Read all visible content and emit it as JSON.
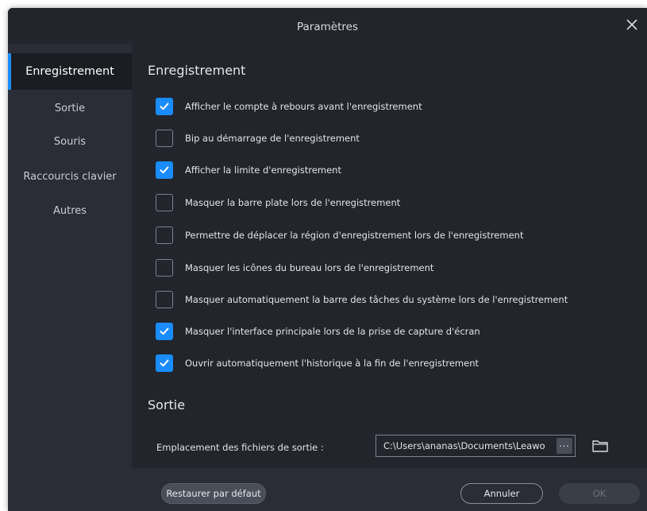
{
  "window": {
    "title": "Paramètres",
    "close_icon": "close-icon"
  },
  "sidebar": {
    "items": [
      {
        "label": "Enregistrement",
        "active": true
      },
      {
        "label": "Sortie",
        "active": false
      },
      {
        "label": "Souris",
        "active": false
      },
      {
        "label": "Raccourcis clavier",
        "active": false
      },
      {
        "label": "Autres",
        "active": false
      }
    ]
  },
  "recording": {
    "section_title": "Enregistrement",
    "options": [
      {
        "label": "Afficher le compte à rebours avant l'enregistrement",
        "checked": true
      },
      {
        "label": "Bip au démarrage de l'enregistrement",
        "checked": false
      },
      {
        "label": "Afficher la limite d'enregistrement",
        "checked": true
      },
      {
        "label": "Masquer la barre plate lors de l'enregistrement",
        "checked": false
      },
      {
        "label": "Permettre de déplacer la région d'enregistrement lors de l'enregistrement",
        "checked": false
      },
      {
        "label": "Masquer les icônes du bureau lors de l'enregistrement",
        "checked": false
      },
      {
        "label": "Masquer automatiquement la barre des tâches du système lors de l'enregistrement",
        "checked": false
      },
      {
        "label": "Masquer l'interface principale lors de la prise de capture d'écran",
        "checked": true
      },
      {
        "label": "Ouvrir automatiquement l'historique à la fin de l'enregistrement",
        "checked": true
      }
    ]
  },
  "output": {
    "section_title": "Sortie",
    "location_label": "Emplacement des fichiers de sortie :",
    "location_value": "C:\\Users\\ananas\\Documents\\Leawo",
    "browse_label": "···",
    "folder_icon": "folder-icon"
  },
  "footer": {
    "restore_label": "Restaurer par défaut",
    "cancel_label": "Annuler",
    "ok_label": "OK"
  },
  "colors": {
    "accent": "#1a8cff",
    "background": "#22252c",
    "sidebar": "#2a2d35"
  }
}
